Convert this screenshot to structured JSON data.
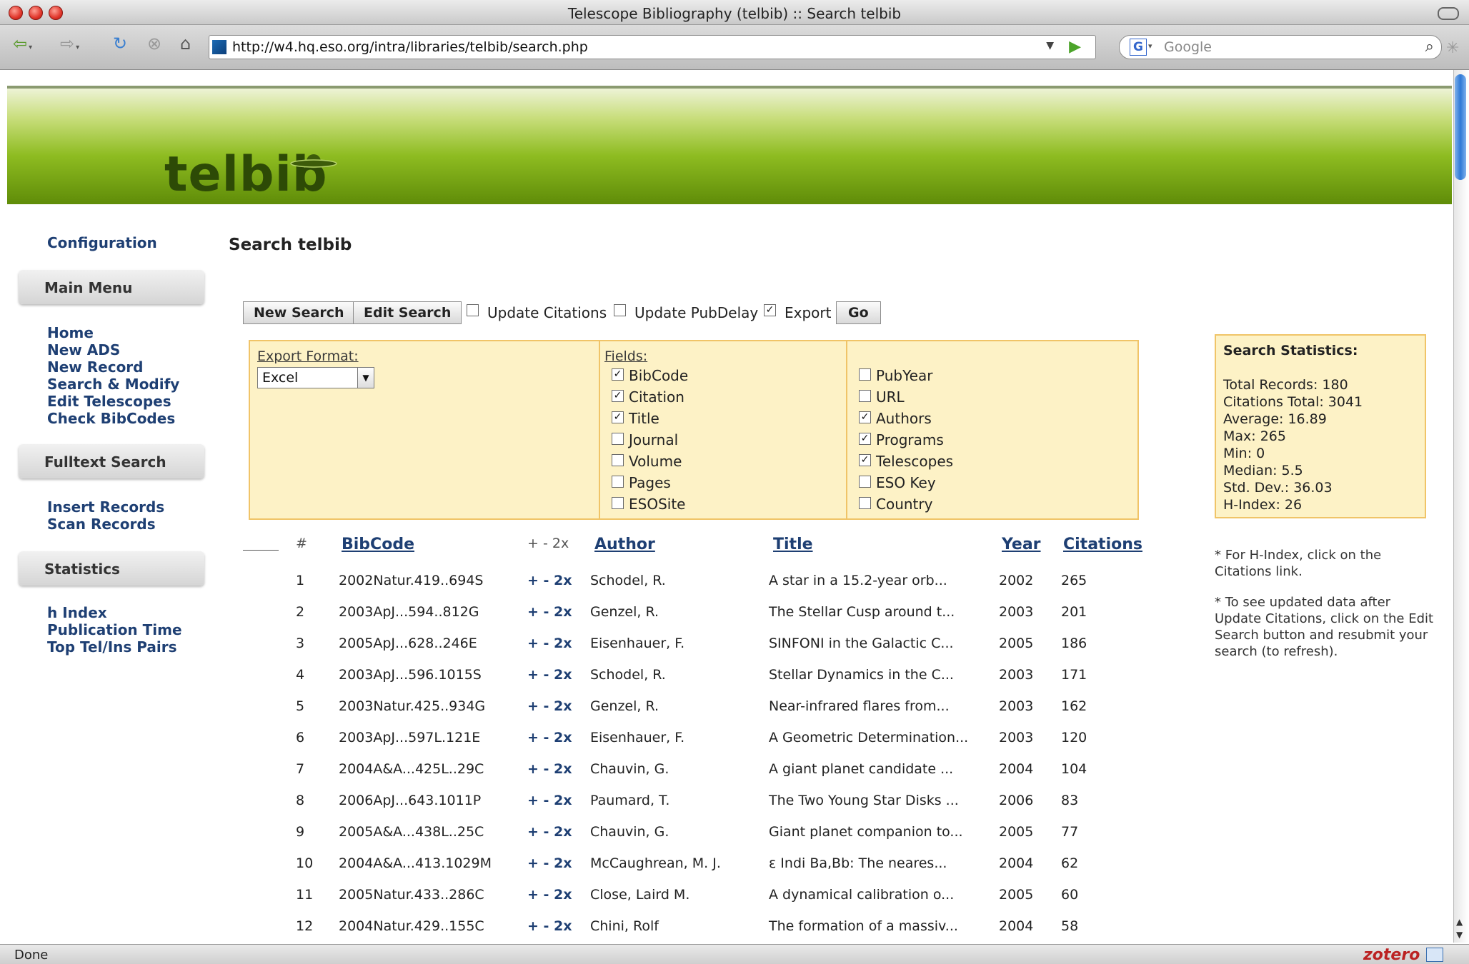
{
  "window": {
    "title": "Telescope Bibliography (telbib) :: Search telbib"
  },
  "browser": {
    "url": "http://w4.hq.eso.org/intra/libraries/telbib/search.php",
    "search_engine_letter": "G",
    "search_placeholder": "Google",
    "status": "Done",
    "addon": "zotero"
  },
  "site": {
    "logo_text": "telbib"
  },
  "sidebar": {
    "config_link": "Configuration",
    "main_menu_heading": "Main Menu",
    "main_menu": [
      "Home",
      "New ADS",
      "New Record",
      "Search & Modify",
      "Edit Telescopes",
      "Check BibCodes"
    ],
    "fulltext_heading": "Fulltext Search",
    "fulltext": [
      "Insert Records",
      "Scan Records"
    ],
    "statistics_heading": "Statistics",
    "statistics": [
      "h Index",
      "Publication Time",
      "Top Tel/Ins Pairs"
    ]
  },
  "main": {
    "title": "Search telbib",
    "buttons": {
      "new_search": "New Search",
      "edit_search": "Edit Search",
      "go": "Go"
    },
    "options": [
      {
        "label": "Update Citations",
        "checked": false
      },
      {
        "label": "Update PubDelay",
        "checked": false
      },
      {
        "label": "Export",
        "checked": true
      }
    ],
    "export": {
      "format_label": "Export Format:",
      "format_value": "Excel",
      "fields_label": "Fields:",
      "fields_col1": [
        {
          "label": "BibCode",
          "checked": true
        },
        {
          "label": "Citation",
          "checked": true
        },
        {
          "label": "Title",
          "checked": true
        },
        {
          "label": "Journal",
          "checked": false
        },
        {
          "label": "Volume",
          "checked": false
        },
        {
          "label": "Pages",
          "checked": false
        },
        {
          "label": "ESOSite",
          "checked": false
        }
      ],
      "fields_col2": [
        {
          "label": "PubYear",
          "checked": false
        },
        {
          "label": "URL",
          "checked": false
        },
        {
          "label": "Authors",
          "checked": true
        },
        {
          "label": "Programs",
          "checked": true
        },
        {
          "label": "Telescopes",
          "checked": true
        },
        {
          "label": "ESO Key",
          "checked": false
        },
        {
          "label": "Country",
          "checked": false
        }
      ]
    }
  },
  "stats": {
    "title": "Search Statistics:",
    "lines": [
      "Total Records: 180",
      "Citations Total: 3041",
      "Average: 16.89",
      "Max: 265",
      "Min: 0",
      "Median: 5.5",
      "Std. Dev.: 36.03",
      "H-Index: 26"
    ],
    "note1": "* For H-Index, click on the Citations link.",
    "note2": "* To see updated data after Update Citations, click on the Edit Search button and resubmit your search (to refresh)."
  },
  "table": {
    "headers": {
      "num": "#",
      "bibcode": "BibCode",
      "actions": "+ - 2x",
      "author": "Author",
      "title": "Title",
      "year": "Year",
      "citations": "Citations"
    },
    "row_actions": "+ - 2x",
    "rows": [
      {
        "num": "1",
        "bibcode": "2002Natur.419..694S",
        "author": "Schodel, R.",
        "title": "A star in a 15.2-year orb...",
        "year": "2002",
        "citations": "265"
      },
      {
        "num": "2",
        "bibcode": "2003ApJ...594..812G",
        "author": "Genzel, R.",
        "title": "The Stellar Cusp around t...",
        "year": "2003",
        "citations": "201"
      },
      {
        "num": "3",
        "bibcode": "2005ApJ...628..246E",
        "author": "Eisenhauer, F.",
        "title": "SINFONI in the Galactic C...",
        "year": "2005",
        "citations": "186"
      },
      {
        "num": "4",
        "bibcode": "2003ApJ...596.1015S",
        "author": "Schodel, R.",
        "title": "Stellar Dynamics in the C...",
        "year": "2003",
        "citations": "171"
      },
      {
        "num": "5",
        "bibcode": "2003Natur.425..934G",
        "author": "Genzel, R.",
        "title": "Near-infrared flares from...",
        "year": "2003",
        "citations": "162"
      },
      {
        "num": "6",
        "bibcode": "2003ApJ...597L.121E",
        "author": "Eisenhauer, F.",
        "title": "A Geometric Determination...",
        "year": "2003",
        "citations": "120"
      },
      {
        "num": "7",
        "bibcode": "2004A&A...425L..29C",
        "author": "Chauvin, G.",
        "title": "A giant planet candidate ...",
        "year": "2004",
        "citations": "104"
      },
      {
        "num": "8",
        "bibcode": "2006ApJ...643.1011P",
        "author": "Paumard, T.",
        "title": "The Two Young Star Disks ...",
        "year": "2006",
        "citations": "83"
      },
      {
        "num": "9",
        "bibcode": "2005A&A...438L..25C",
        "author": "Chauvin, G.",
        "title": "Giant planet companion to...",
        "year": "2005",
        "citations": "77"
      },
      {
        "num": "10",
        "bibcode": "2004A&A...413.1029M",
        "author": "McCaughrean, M. J.",
        "title": "ε Indi Ba,Bb: The neares...",
        "year": "2004",
        "citations": "62"
      },
      {
        "num": "11",
        "bibcode": "2005Natur.433..286C",
        "author": "Close, Laird M.",
        "title": "A dynamical calibration o...",
        "year": "2005",
        "citations": "60"
      },
      {
        "num": "12",
        "bibcode": "2004Natur.429..155C",
        "author": "Chini, Rolf",
        "title": "The formation of a massiv...",
        "year": "2004",
        "citations": "58"
      }
    ]
  },
  "colors": {
    "link": "#1e3f73",
    "panel_bg": "#fdf2c6",
    "panel_border": "#f0c468",
    "banner_green": "#8ebc21"
  }
}
